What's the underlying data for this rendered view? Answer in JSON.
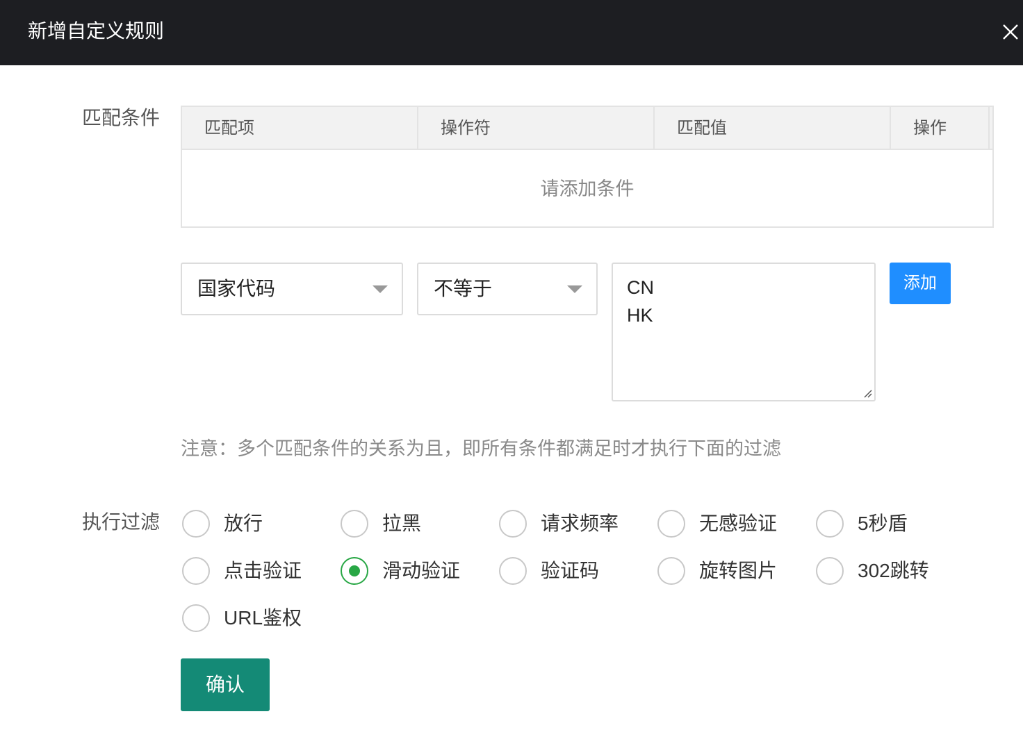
{
  "dialog": {
    "title": "新增自定义规则",
    "close_icon": "close-icon"
  },
  "conditions": {
    "label": "匹配条件",
    "columns": [
      "匹配项",
      "操作符",
      "匹配值",
      "操作"
    ],
    "empty_text": "请添加条件",
    "match_item": "国家代码",
    "operator": "不等于",
    "match_values": [
      "CN",
      "HK"
    ],
    "add_label": "添加",
    "note": "注意：多个匹配条件的关系为且，即所有条件都满足时才执行下面的过滤"
  },
  "filter": {
    "label": "执行过滤",
    "options": [
      "放行",
      "拉黑",
      "请求频率",
      "无感验证",
      "5秒盾",
      "点击验证",
      "滑动验证",
      "验证码",
      "旋转图片",
      "302跳转",
      "URL鉴权"
    ],
    "selected": "滑动验证"
  },
  "confirm_label": "确认",
  "colors": {
    "titlebar_bg": "#1d1e22",
    "add_button": "#1f8eff",
    "confirm_button": "#148a76",
    "radio_selected": "#28a745"
  }
}
